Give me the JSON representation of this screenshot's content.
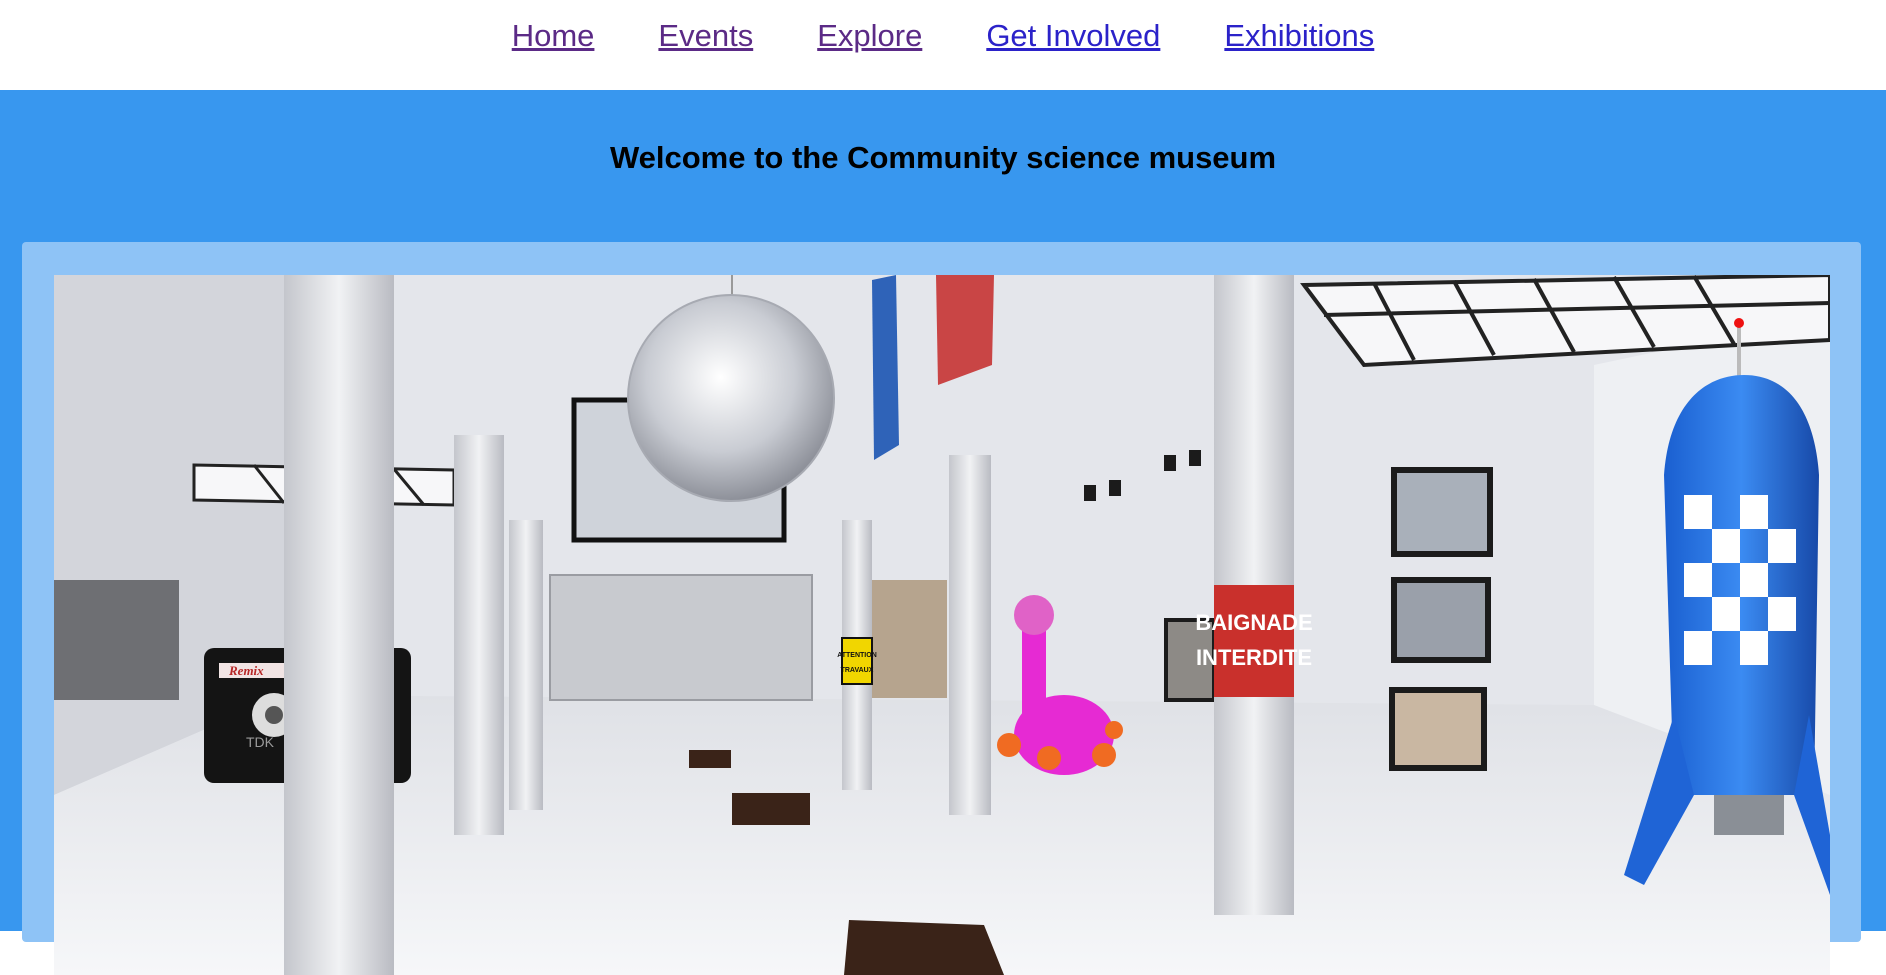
{
  "nav": {
    "items": [
      {
        "label": "Home",
        "state": "visited"
      },
      {
        "label": "Events",
        "state": "visited"
      },
      {
        "label": "Explore",
        "state": "visited"
      },
      {
        "label": "Get Involved",
        "state": "unvisited"
      },
      {
        "label": "Exhibitions",
        "state": "unvisited"
      }
    ]
  },
  "hero": {
    "title": "Welcome to the Community science museum",
    "background": "#3897ef",
    "frame_color": "#8ec3f6"
  },
  "image": {
    "signs": {
      "red_sign_line1": "BAIGNADE",
      "red_sign_line2": "INTERDITE",
      "yellow_sign_line1": "ATTENTION",
      "yellow_sign_line2": "TRAVAUX",
      "cassette_label": "Remix",
      "cassette_brand": "TDK"
    }
  }
}
